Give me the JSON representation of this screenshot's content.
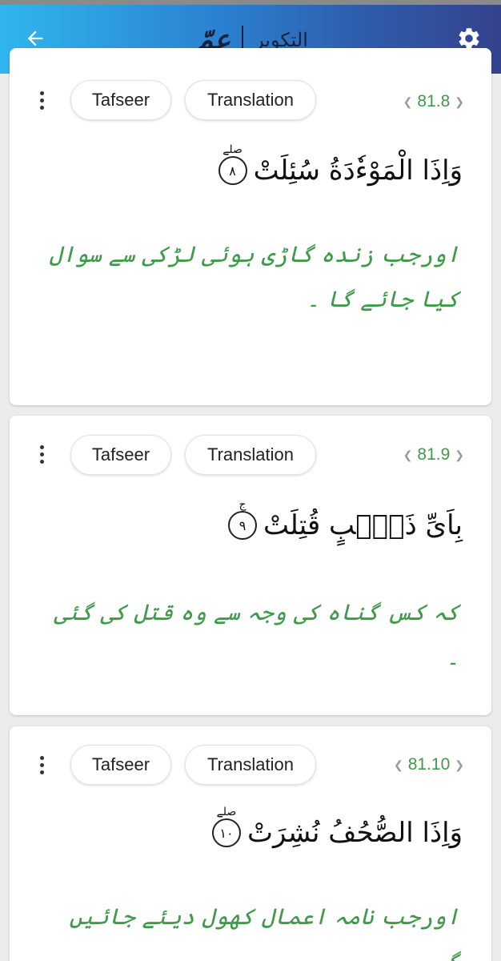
{
  "appbar": {
    "title_surah": "التكوير",
    "title_juz": "عمّ"
  },
  "icons": {
    "back": "arrow-left-icon",
    "settings": "gear-icon",
    "more": "more-vertical-icon"
  },
  "colors": {
    "accent_green": "#3f9a4a",
    "header_start": "#2fb6ee",
    "header_end": "#35428e"
  },
  "verses": [
    {
      "tafseer_label": "Tafseer",
      "translation_label": "Translation",
      "ref": "81.8",
      "arabic": "وَاِذَا الْمَوْءٗدَةُ سُئِلَتْ",
      "ayah_number": "٨",
      "pause_mark": "صلے",
      "urdu": "اورجب زندہ گاڑی ہوئی لڑکی سے سوال کیا جائے گا ۔"
    },
    {
      "tafseer_label": "Tafseer",
      "translation_label": "Translation",
      "ref": "81.9",
      "arabic": "بِاَیِّ ذَنْۢبٍ قُتِلَتْ",
      "ayah_number": "٩",
      "pause_mark": "ج",
      "urdu": "کہ کس گناہ کی وجہ سے وہ قتل کی گئی ۔"
    },
    {
      "tafseer_label": "Tafseer",
      "translation_label": "Translation",
      "ref": "81.10",
      "arabic": "وَاِذَا الصُّحُفُ نُشِرَتْ",
      "ayah_number": "١٠",
      "pause_mark": "صلے",
      "urdu": "اورجب نامہ اعمال کھول دیئے جائیں گے ۔"
    }
  ]
}
